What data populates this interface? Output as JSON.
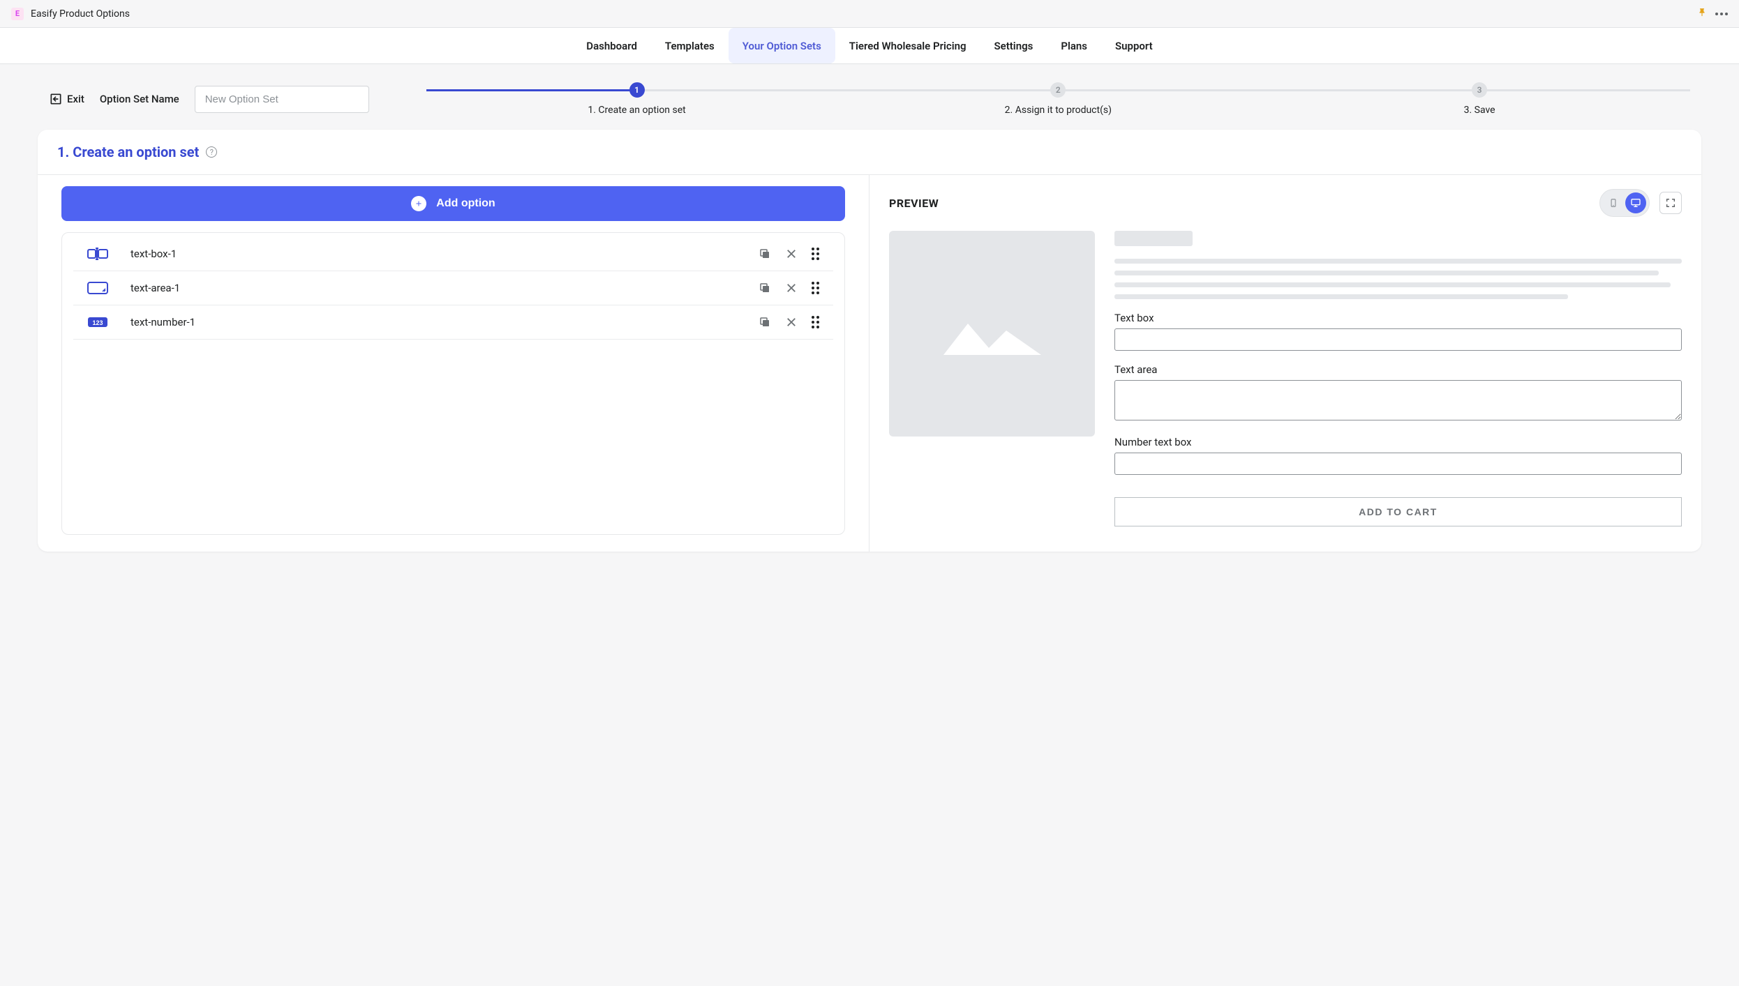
{
  "titlebar": {
    "title": "Easify Product Options"
  },
  "nav": {
    "tabs": [
      {
        "label": "Dashboard",
        "active": false
      },
      {
        "label": "Templates",
        "active": false
      },
      {
        "label": "Your Option Sets",
        "active": true
      },
      {
        "label": "Tiered Wholesale Pricing",
        "active": false
      },
      {
        "label": "Settings",
        "active": false
      },
      {
        "label": "Plans",
        "active": false
      },
      {
        "label": "Support",
        "active": false
      }
    ]
  },
  "subheader": {
    "exit_label": "Exit",
    "name_label": "Option Set Name",
    "name_placeholder": "New Option Set",
    "steps": [
      {
        "num": "1",
        "label": "1. Create an option set",
        "active": true
      },
      {
        "num": "2",
        "label": "2. Assign it to product(s)",
        "active": false
      },
      {
        "num": "3",
        "label": "3. Save",
        "active": false
      }
    ]
  },
  "card": {
    "title": "1. Create an option set",
    "add_label": "Add option",
    "options": [
      {
        "icon": "textbox",
        "label": "text-box-1"
      },
      {
        "icon": "textarea",
        "label": "text-area-1"
      },
      {
        "icon": "number",
        "label": "text-number-1"
      }
    ]
  },
  "preview": {
    "title": "PREVIEW",
    "fields": [
      {
        "label": "Text box",
        "type": "text"
      },
      {
        "label": "Text area",
        "type": "textarea"
      },
      {
        "label": "Number text box",
        "type": "text"
      }
    ],
    "cart_label": "ADD TO CART"
  }
}
